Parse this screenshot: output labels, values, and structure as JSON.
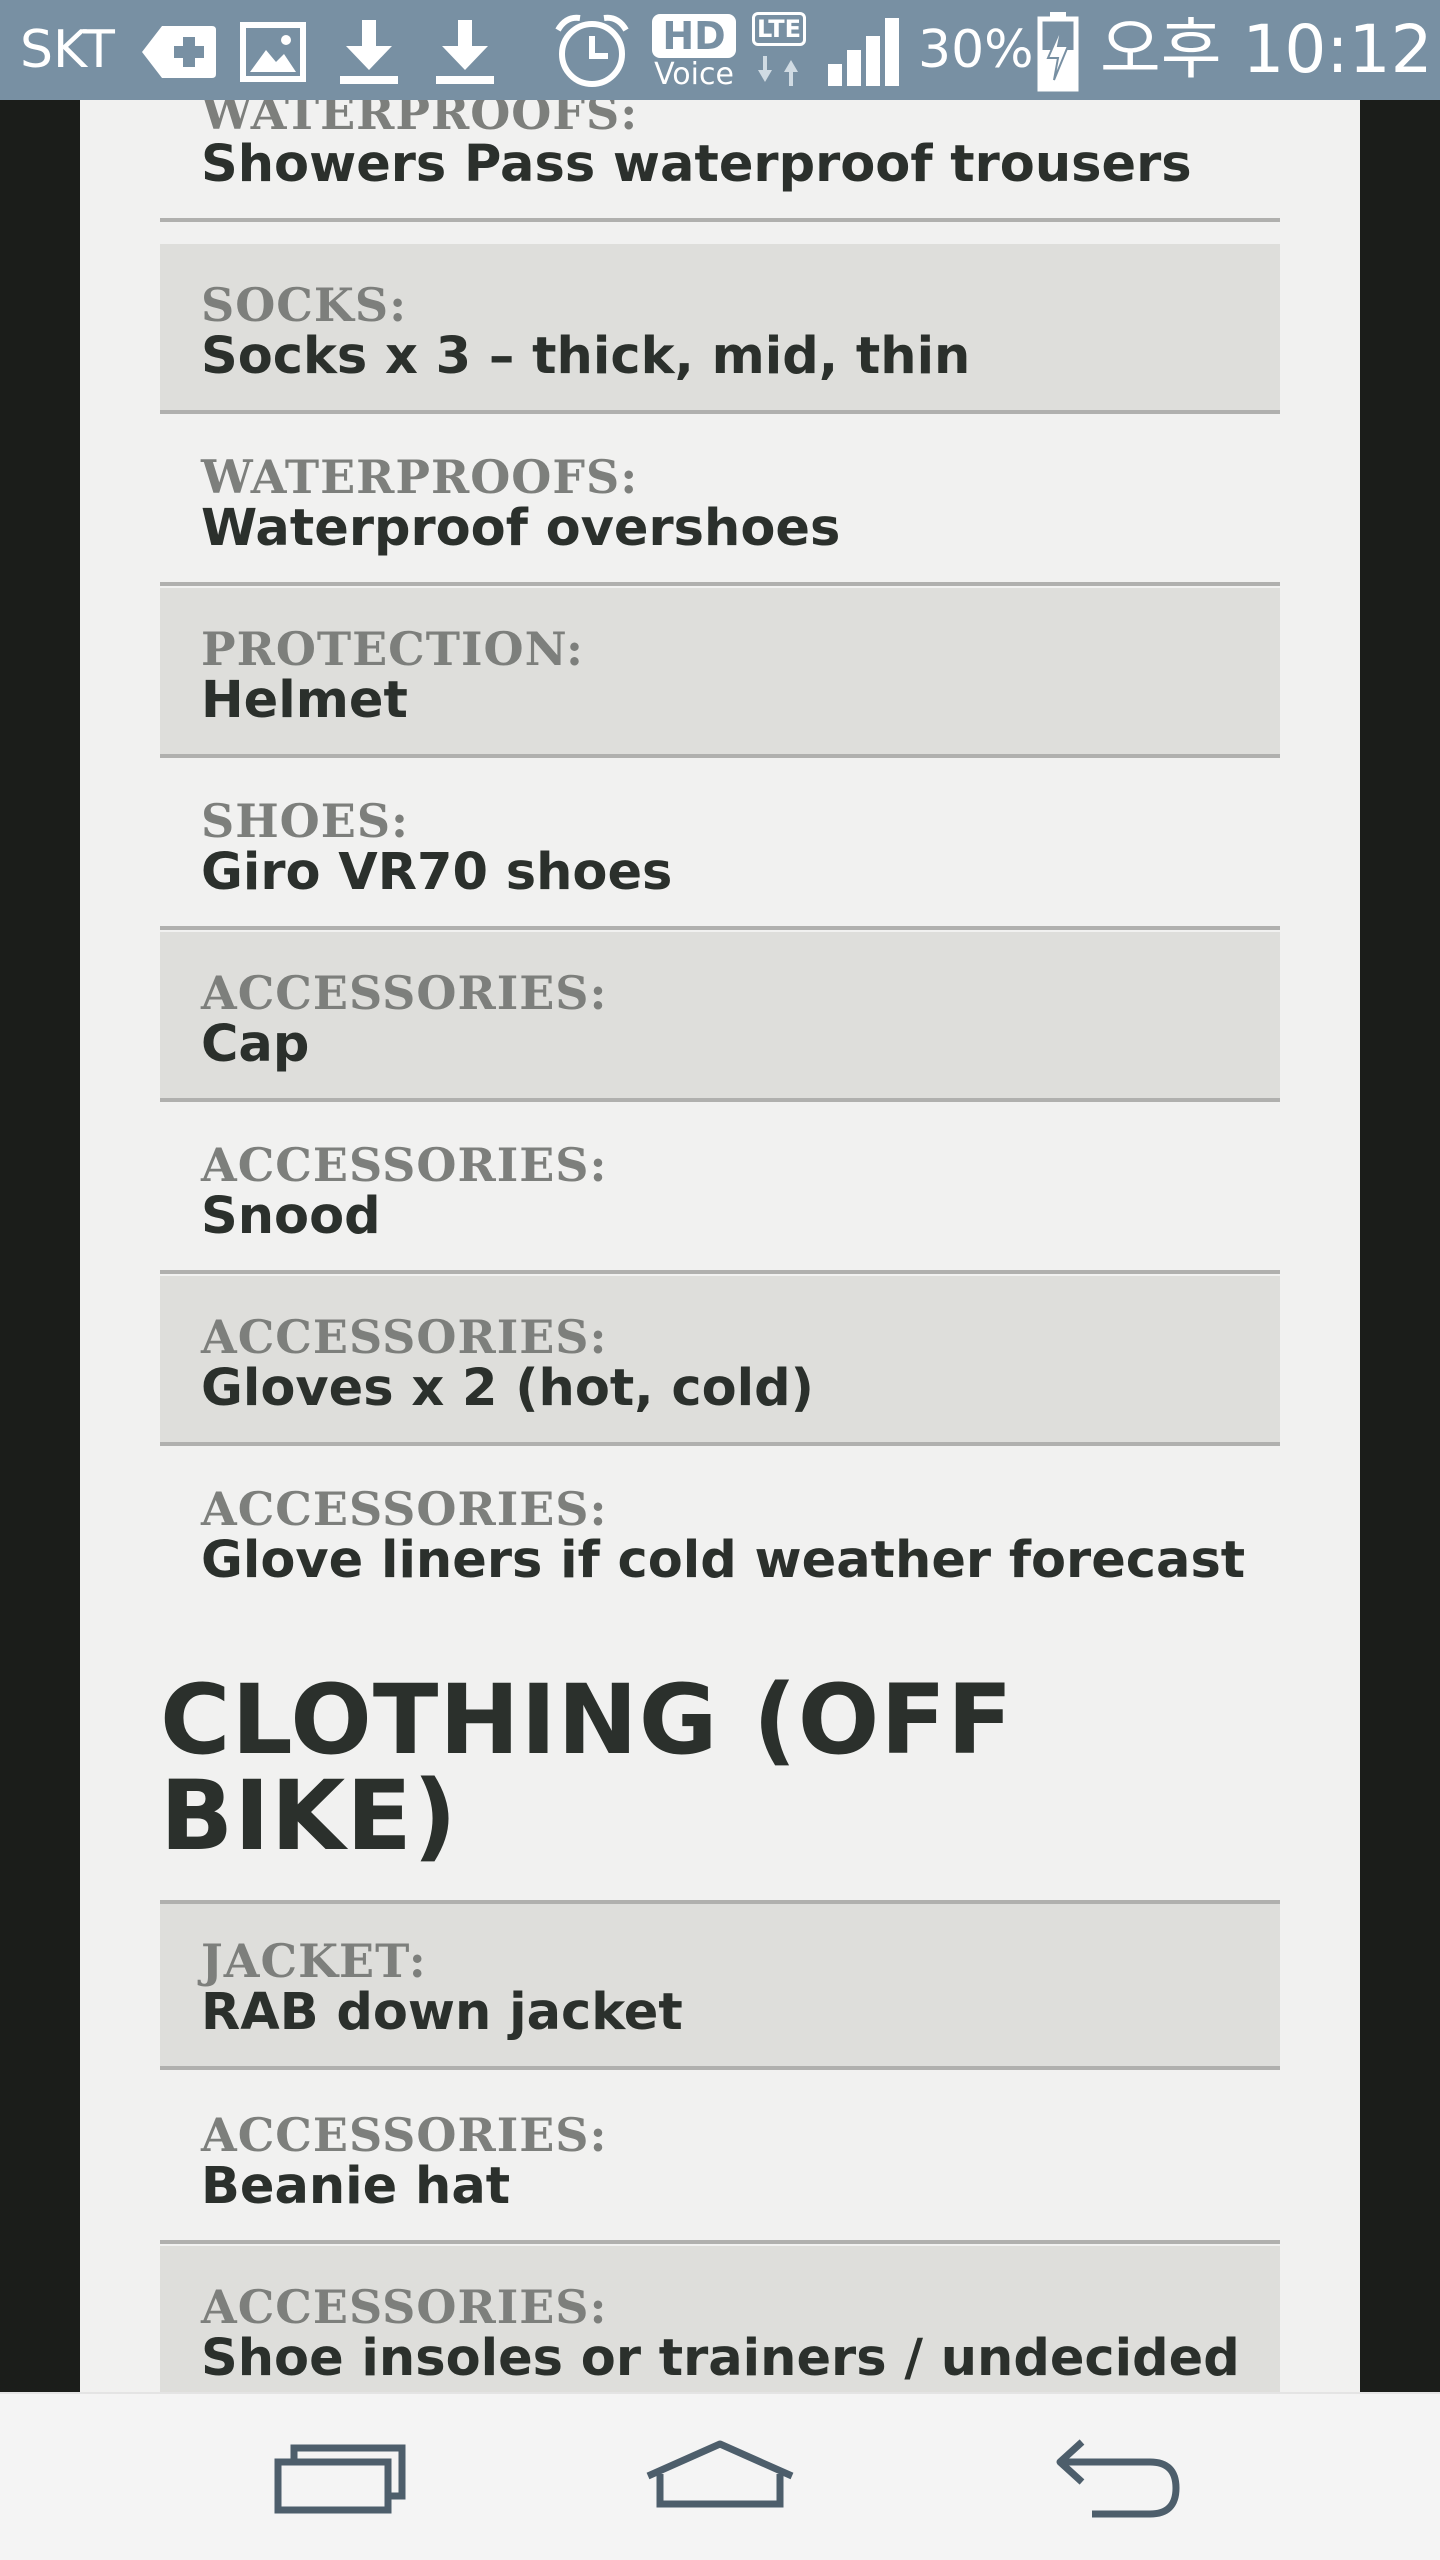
{
  "status_bar": {
    "carrier": "SKT",
    "hd_label": "HD",
    "hd_sub": "Voice",
    "lte_label": "LTE",
    "battery_percent": "30%",
    "time": "오후 10:12",
    "icons": [
      "medical-plus-icon",
      "image-icon",
      "download-icon",
      "download-icon",
      "alarm-clock-icon",
      "hd-voice-icon",
      "lte-data-icon",
      "signal-bars-icon",
      "battery-charging-icon"
    ]
  },
  "list_items": [
    {
      "category": "WATERPROOFS:",
      "value": "Showers Pass waterproof trousers"
    },
    {
      "category": "SOCKS:",
      "value": "Socks x 3 – thick, mid, thin"
    },
    {
      "category": "WATERPROOFS:",
      "value": "Waterproof overshoes"
    },
    {
      "category": "PROTECTION:",
      "value": "Helmet"
    },
    {
      "category": "SHOES:",
      "value": "Giro VR70 shoes"
    },
    {
      "category": "ACCESSORIES:",
      "value": "Cap"
    },
    {
      "category": "ACCESSORIES:",
      "value": "Snood"
    },
    {
      "category": "ACCESSORIES:",
      "value": "Gloves x 2 (hot, cold)"
    },
    {
      "category": "ACCESSORIES:",
      "value": "Glove liners if cold weather forecast"
    }
  ],
  "section": {
    "heading_line1": "CLOTHING (OFF",
    "heading_line2": "BIKE)"
  },
  "off_bike_items": [
    {
      "category": "JACKET:",
      "value": "RAB down jacket"
    },
    {
      "category": "ACCESSORIES:",
      "value": "Beanie hat"
    },
    {
      "category": "ACCESSORIES:",
      "value": "Shoe insoles or trainers / undecided"
    }
  ],
  "nav_bar": {
    "icons": [
      "recent-apps-icon",
      "home-icon",
      "back-icon"
    ]
  },
  "colors": {
    "status_bar_bg": "#7890a3",
    "page_bg": "#f1f1f0",
    "row_shaded_bg": "#dededb",
    "category_text": "#7d7f7c",
    "value_text": "#2b302c",
    "side_margin_bg": "#1b1d1a"
  }
}
